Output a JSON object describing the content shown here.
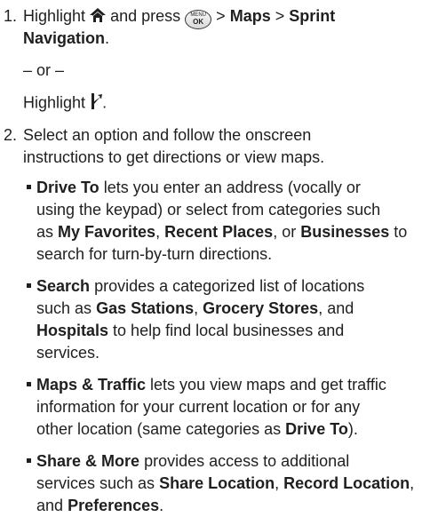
{
  "step1": {
    "number": "1.",
    "highlight_word": "Highlight",
    "and_press": "and press",
    "sep1": ">",
    "menu_maps": "Maps",
    "sep2": ">",
    "menu_sprint": "Sprint",
    "menu_navigation": "Navigation",
    "period": ".",
    "or_text": "– or –",
    "highlight_word2": "Highlight",
    "period2": ".",
    "home_icon": "home-icon",
    "menu_ok_icon": "menu-ok-key-icon",
    "menu_key_top": "MENU",
    "menu_key_bottom": "OK",
    "nav_icon": "navigation-arrow-icon"
  },
  "step2": {
    "number": "2.",
    "line1": "Select an option and follow the onscreen",
    "line2": "instructions to get directions or view maps."
  },
  "bullets": {
    "drive": {
      "title": "Drive To",
      "l1": "lets you enter an address (vocally or",
      "l2": "using the keypad) or select from categories such",
      "l3": "as",
      "fav": "My Favorites",
      "c1": ",",
      "recent": "Recent Places",
      "c2": ", or",
      "biz": "Businesses",
      "l3end": "to",
      "l4": "search for turn-by-turn directions."
    },
    "search": {
      "title": "Search",
      "l1": "provides a categorized list of locations",
      "l2a": "such as",
      "gas": "Gas Stations",
      "c1": ",",
      "grocery": "Grocery Stores",
      "c2": ", and",
      "hosp": "Hospitals",
      "l3": "to help find local businesses and",
      "l4": "services."
    },
    "maps": {
      "title": "Maps & Traffic",
      "l1": "lets you view maps and get traffic",
      "l2": "information for your current location or for any",
      "l3a": "other location (same categories as",
      "drive": "Drive To",
      "l3b": ")."
    },
    "share": {
      "title": "Share & More",
      "l1": "provides access to additional",
      "l2a": "services such as",
      "shareloc": "Share Location",
      "c1": ",",
      "record": "Record Location",
      "c2": ",",
      "l3a": "and",
      "prefs": "Preferences",
      "l3b": "."
    }
  },
  "colors": {
    "text": "#1f1f1f"
  }
}
